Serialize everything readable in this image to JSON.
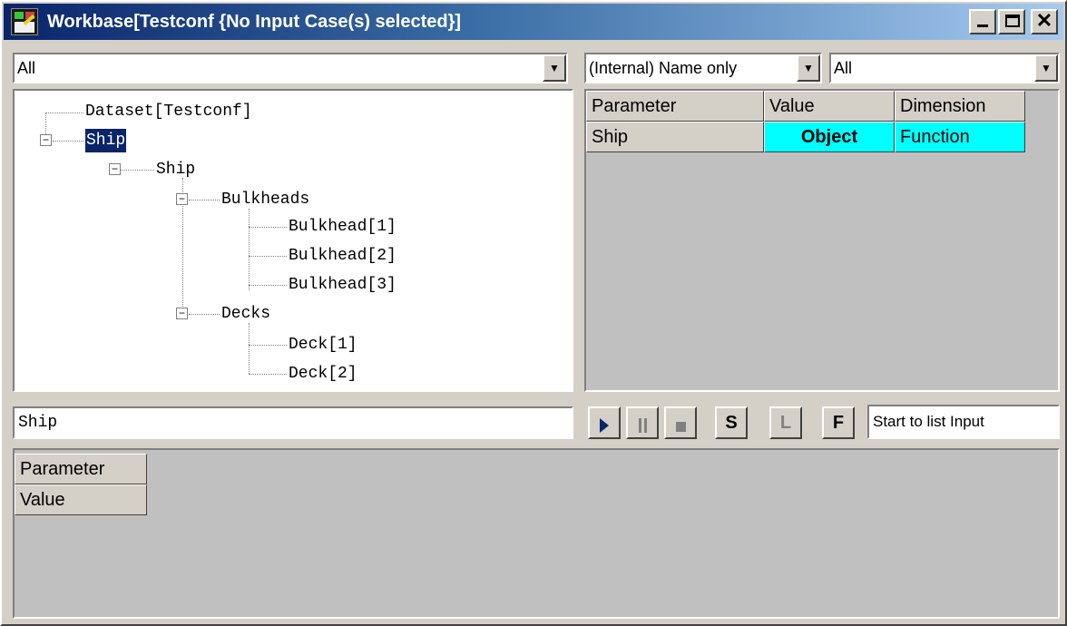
{
  "window": {
    "title": "Workbase[Testconf  {No Input Case(s) selected}]",
    "close_glyph": "✕"
  },
  "filters": {
    "left_combo": "All",
    "name_mode_combo": "(Internal) Name only",
    "right_combo": "All"
  },
  "tree": {
    "nodes": [
      {
        "label": "Dataset[Testconf]",
        "selected": false
      },
      {
        "label": "Ship",
        "selected": true,
        "expander": "−"
      },
      {
        "label": "Ship",
        "expander": "−"
      },
      {
        "label": "Bulkheads",
        "expander": "−"
      },
      {
        "label": "Bulkhead[1]"
      },
      {
        "label": "Bulkhead[2]"
      },
      {
        "label": "Bulkhead[3]"
      },
      {
        "label": "Decks",
        "expander": "−"
      },
      {
        "label": "Deck[1]"
      },
      {
        "label": "Deck[2]"
      }
    ]
  },
  "param_grid": {
    "headers": [
      "Parameter",
      "Value",
      "Dimension"
    ],
    "rows": [
      {
        "parameter": "Ship",
        "value": "Object",
        "dimension": "Function"
      }
    ],
    "highlight_color": "#00ffff"
  },
  "path_field": {
    "value": "Ship"
  },
  "controls": {
    "play_icon": "play-icon",
    "pause_icon": "pause-icon",
    "stop_icon": "stop-icon",
    "s_label": "S",
    "l_label": "L",
    "f_label": "F",
    "status": "Start to list Input"
  },
  "detail_grid": {
    "rows": [
      "Parameter",
      "Value"
    ]
  }
}
